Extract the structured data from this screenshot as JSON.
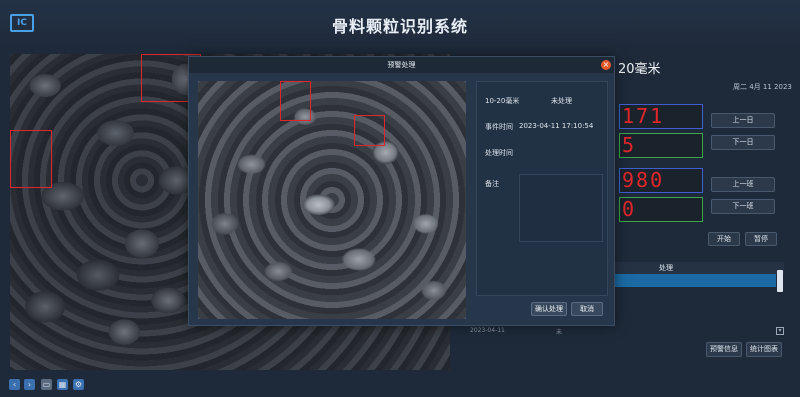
{
  "header": {
    "logo_text": "IC",
    "title": "骨料颗粒识别系统"
  },
  "right_panel": {
    "title_partial": "20毫米",
    "date": "周二 4月 11 2023",
    "counters": [
      "171",
      "5",
      "980",
      "0"
    ],
    "buttons": {
      "prev_day": "上一日",
      "next_day": "下一日",
      "prev_shift": "上一班",
      "next_shift": "下一班",
      "start": "开始",
      "pause": "暂停",
      "warning_info": "预警信息",
      "stats_chart": "统计图表"
    },
    "table": {
      "header_process": "处理",
      "row_peek_date": "2023-04-11",
      "row_peek_value": "未"
    }
  },
  "modal": {
    "title": "预警处理",
    "close_symbol": "×",
    "fields": {
      "size_label": "10-20毫米",
      "size_value": "未处理",
      "event_time_label": "事件时间",
      "event_time_value": "2023-04-11 17:10:54",
      "process_time_label": "处理时间",
      "remark_label": "备注"
    },
    "buttons": {
      "confirm": "确认处理",
      "cancel": "取消"
    }
  },
  "colors": {
    "background": "#1e2a3a",
    "lcd_digits": "#e2262a",
    "detection_box": "#e0262a",
    "selected_row": "#1b6aa4"
  }
}
